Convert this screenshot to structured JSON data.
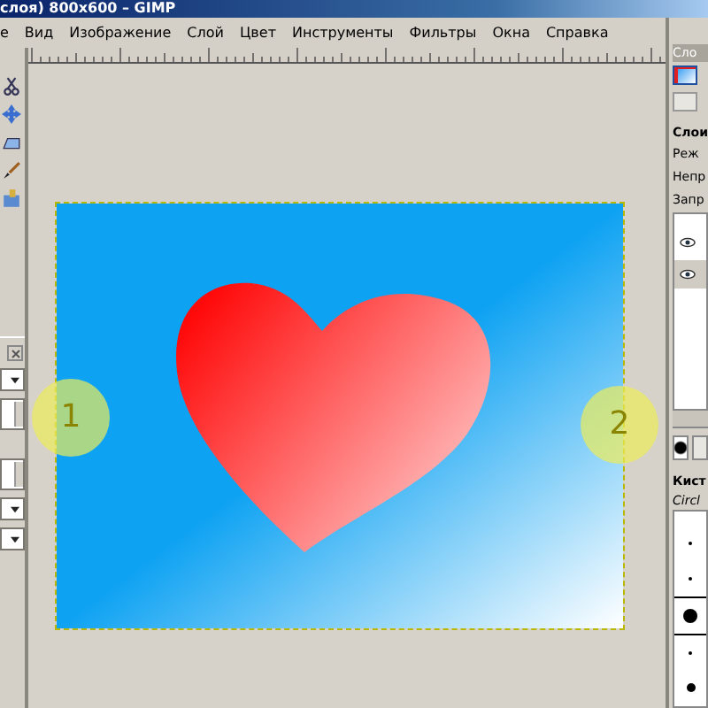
{
  "window": {
    "title": "слоя) 800x600 – GIMP"
  },
  "menu": [
    {
      "label": "е"
    },
    {
      "label": "Вид"
    },
    {
      "label": "Изображение"
    },
    {
      "label": "Слой"
    },
    {
      "label": "Цвет"
    },
    {
      "label": "Инструменты"
    },
    {
      "label": "Фильтры"
    },
    {
      "label": "Окна"
    },
    {
      "label": "Справка"
    }
  ],
  "dock": {
    "title": "Сло",
    "heading": "Слои",
    "labels": [
      "Реж",
      "Непр",
      "Запр"
    ],
    "layers": [
      {
        "selected": false
      },
      {
        "selected": true
      }
    ],
    "brushes_heading": "Кист",
    "brush_set": "Circl",
    "brushes": [
      {
        "selected": false
      },
      {
        "selected": false
      },
      {
        "selected": true
      },
      {
        "selected": false
      },
      {
        "selected": false
      }
    ]
  },
  "markers": [
    "1",
    "2"
  ]
}
